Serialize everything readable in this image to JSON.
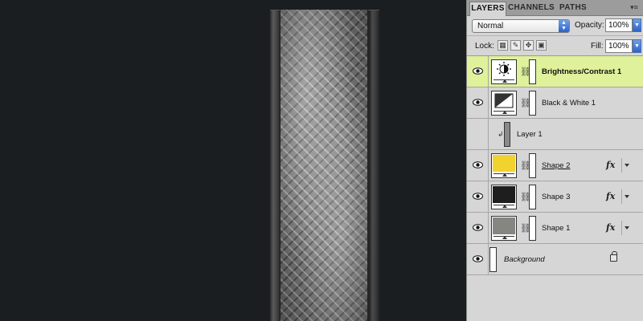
{
  "panel": {
    "tabs": [
      {
        "label": "LAYERS",
        "active": true
      },
      {
        "label": "CHANNELS",
        "active": false
      },
      {
        "label": "PATHS",
        "active": false
      }
    ],
    "menu_glyph": "▾≡",
    "blend_mode": "Normal",
    "opacity_label": "Opacity:",
    "opacity_value": "100%",
    "lock_label": "Lock:",
    "fill_label": "Fill:",
    "fill_value": "100%"
  },
  "layers": [
    {
      "name": "Brightness/Contrast 1",
      "kind": "adjustment",
      "selected": true,
      "visible": true
    },
    {
      "name": "Black & White 1",
      "kind": "adjustment",
      "selected": false,
      "visible": true
    },
    {
      "name": "Layer 1",
      "kind": "clipped",
      "selected": false,
      "visible": false
    },
    {
      "name": "Shape 2",
      "kind": "shape",
      "color": "#f2d22e",
      "fx": "fx",
      "underlined": true,
      "visible": true
    },
    {
      "name": "Shape 3",
      "kind": "shape",
      "color": "#1e1e1e",
      "fx": "fx",
      "visible": true
    },
    {
      "name": "Shape 1",
      "kind": "shape",
      "color": "#858581",
      "fx": "fx",
      "visible": true
    },
    {
      "name": "Background",
      "kind": "background",
      "locked": true,
      "visible": true
    }
  ],
  "colors": {
    "canvas_bg": "#1b1e20",
    "selected_row": "#dff19a",
    "panel_bg": "#d6d6d6"
  }
}
